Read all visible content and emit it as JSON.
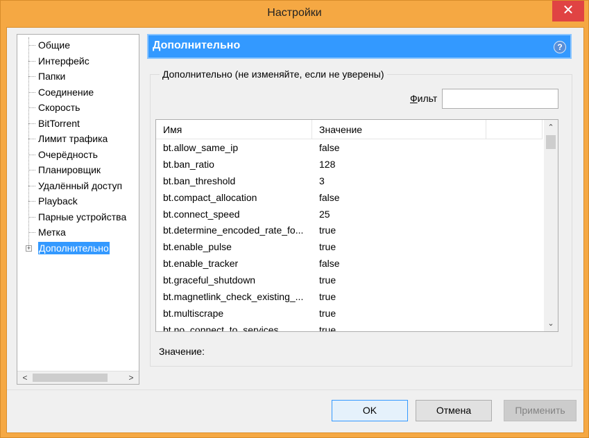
{
  "window": {
    "title": "Настройки",
    "close_glyph": "✕"
  },
  "tree": {
    "items": [
      {
        "label": "Общие"
      },
      {
        "label": "Интерфейс"
      },
      {
        "label": "Папки"
      },
      {
        "label": "Соединение"
      },
      {
        "label": "Скорость"
      },
      {
        "label": "BitTorrent"
      },
      {
        "label": "Лимит трафика"
      },
      {
        "label": "Очерёдность"
      },
      {
        "label": "Планировщик"
      },
      {
        "label": "Удалённый доступ"
      },
      {
        "label": "Playback"
      },
      {
        "label": "Парные устройства"
      },
      {
        "label": "Метка"
      },
      {
        "label": "Дополнительно",
        "selected": true,
        "expandable": true
      }
    ],
    "scroll_left": "<",
    "scroll_right": ">"
  },
  "header": {
    "title": "Дополнительно",
    "help_glyph": "?"
  },
  "group": {
    "legend": "Дополнительно (не изменяйте, если не уверены)",
    "filter_label_underlined": "Ф",
    "filter_label_rest": "ильт",
    "filter_value": ""
  },
  "list": {
    "columns": [
      "Имя",
      "Значение",
      ""
    ],
    "rows": [
      {
        "name": "bt.allow_same_ip",
        "value": "false"
      },
      {
        "name": "bt.ban_ratio",
        "value": "128"
      },
      {
        "name": "bt.ban_threshold",
        "value": "3"
      },
      {
        "name": "bt.compact_allocation",
        "value": "false"
      },
      {
        "name": "bt.connect_speed",
        "value": "25"
      },
      {
        "name": "bt.determine_encoded_rate_fo...",
        "value": "true"
      },
      {
        "name": "bt.enable_pulse",
        "value": "true"
      },
      {
        "name": "bt.enable_tracker",
        "value": "false"
      },
      {
        "name": "bt.graceful_shutdown",
        "value": "true"
      },
      {
        "name": "bt.magnetlink_check_existing_...",
        "value": "true"
      },
      {
        "name": "bt.multiscrape",
        "value": "true"
      },
      {
        "name": "bt.no_connect_to_services",
        "value": "true"
      }
    ],
    "scroll_up": "⌃",
    "scroll_down": "⌄"
  },
  "value_label": "Значение:",
  "buttons": {
    "ok": "OK",
    "cancel": "Отмена",
    "apply": "Применить"
  },
  "colors": {
    "accent": "#3399ff",
    "frame": "#f5a843",
    "close": "#e04343"
  }
}
